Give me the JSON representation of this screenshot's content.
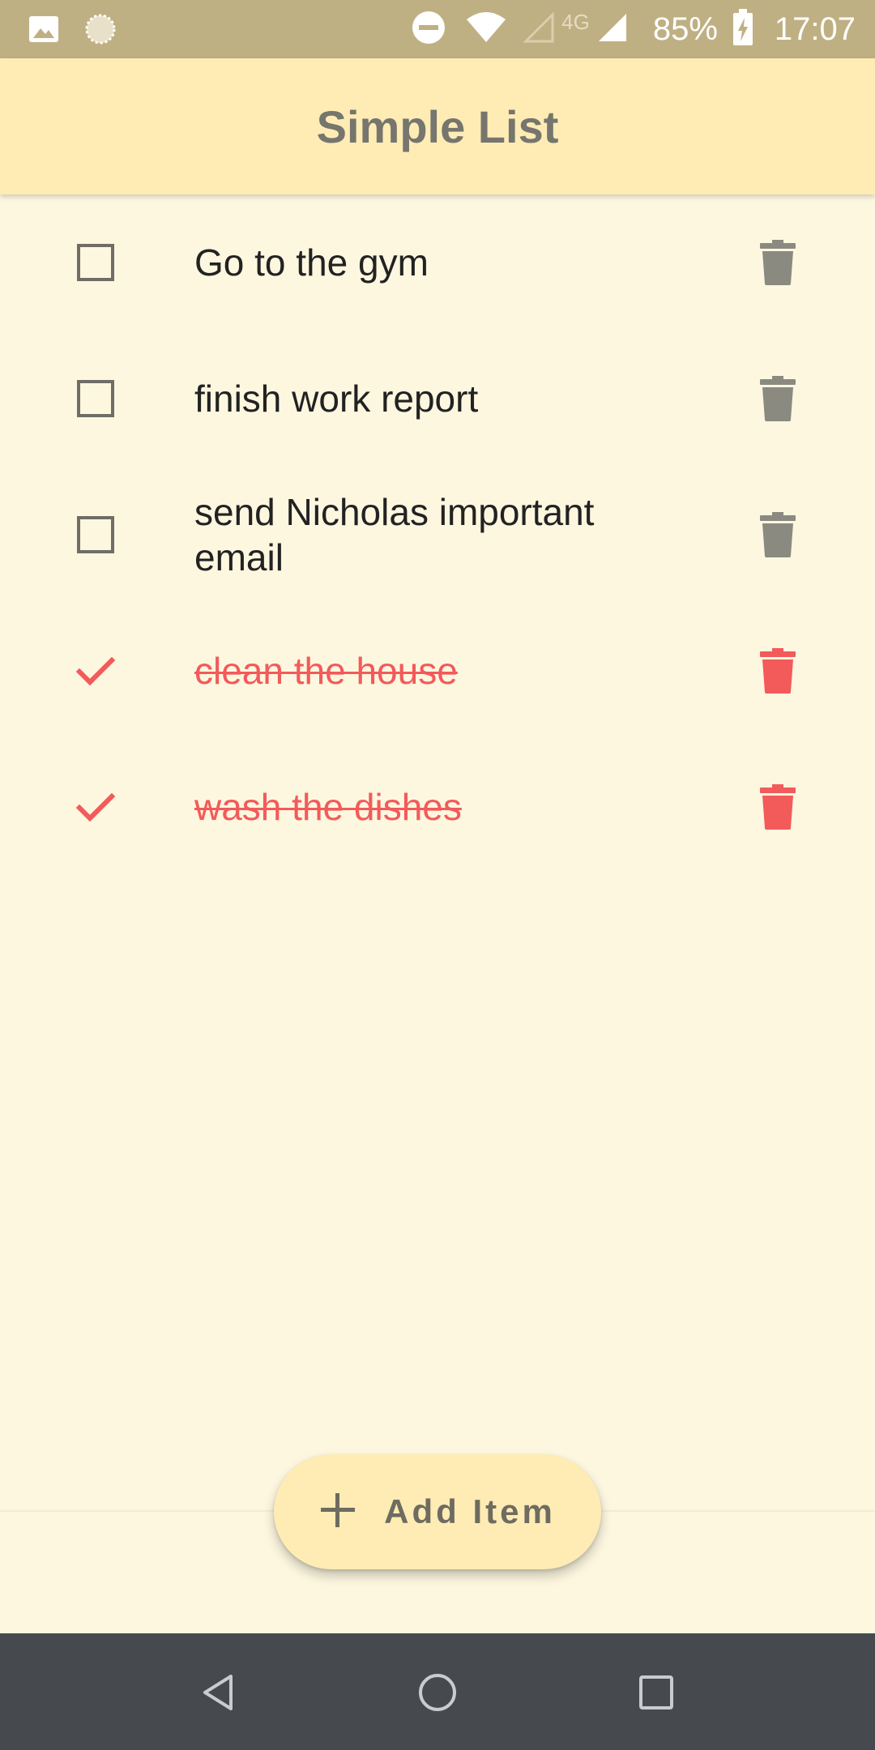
{
  "status_bar": {
    "battery": "85%",
    "time": "17:07",
    "network": "4G",
    "icons": [
      "gallery-icon",
      "sync-icon",
      "do-not-disturb-icon",
      "wifi-icon",
      "signal-empty-icon",
      "signal-icon",
      "battery-charging-icon"
    ]
  },
  "app_bar": {
    "title": "Simple List"
  },
  "items": [
    {
      "label": "Go to the gym",
      "done": false
    },
    {
      "label": "finish work report",
      "done": false
    },
    {
      "label": "send Nicholas important email",
      "done": false
    },
    {
      "label": "clean the house",
      "done": true
    },
    {
      "label": "wash the dishes",
      "done": true
    }
  ],
  "fab": {
    "label": "Add Item",
    "icon": "plus-icon"
  },
  "nav": {
    "icons": [
      "back-icon",
      "home-icon",
      "recents-icon"
    ]
  },
  "colors": {
    "background": "#fdf7e0",
    "app_bar": "#feecb4",
    "status_bar": "#bfb084",
    "done_accent": "#f35a5a",
    "trash_default": "#8b8a81",
    "nav_bar": "#464a4e"
  }
}
